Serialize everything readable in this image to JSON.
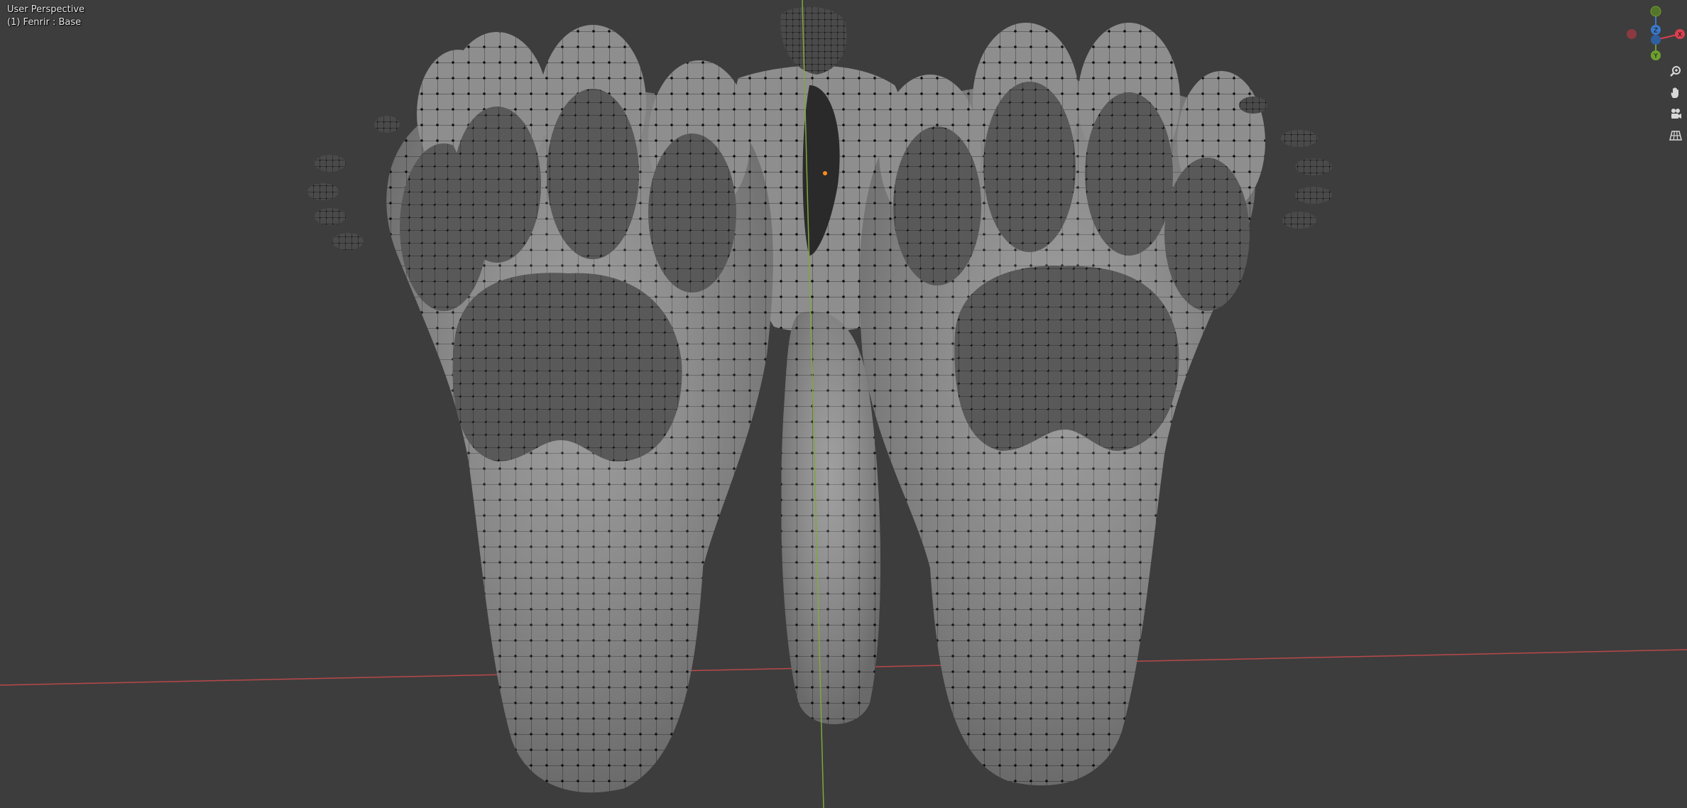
{
  "viewport": {
    "view_name": "User Perspective",
    "object_info": "(1) Fenrir : Base"
  },
  "gizmo": {
    "x_label": "X",
    "y_label": "Y",
    "z_label": "Z",
    "x_color": "#d9404f",
    "y_color": "#6fa02f",
    "z_color": "#3c78c8"
  },
  "tools": [
    {
      "name": "zoom",
      "icon": "magnifier-icon"
    },
    {
      "name": "pan",
      "icon": "hand-icon"
    },
    {
      "name": "camera",
      "icon": "camera-icon"
    },
    {
      "name": "ortho",
      "icon": "grid-icon"
    }
  ],
  "colors": {
    "background": "#3d3d3d",
    "mesh_fill": "#8a8a8a",
    "pad_fill": "#5a5a5a",
    "vertex": "#101010",
    "x_axis_line": "#c0504a",
    "y_axis_line": "#7fa83a",
    "origin": "#ff8c1a"
  }
}
